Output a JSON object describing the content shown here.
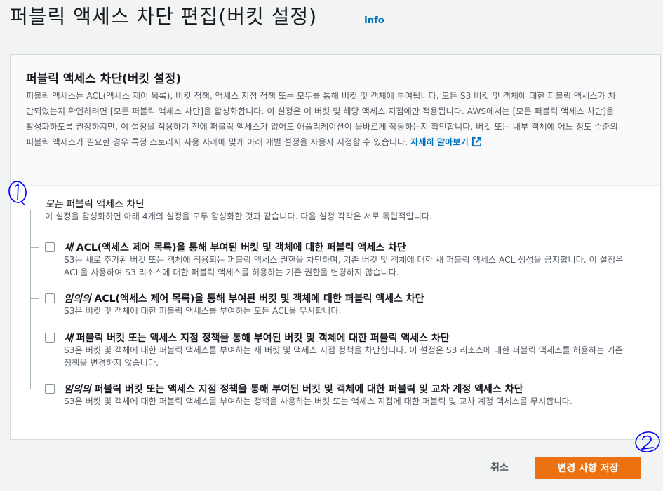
{
  "page": {
    "title": "퍼블릭 액세스 차단 편집(버킷 설정)",
    "info_link": "Info"
  },
  "panel": {
    "title": "퍼블릭 액세스 차단(버킷 설정)",
    "description": "퍼블릭 액세스는 ACL(액세스 제어 목록), 버킷 정책, 액세스 지점 정책 또는 모두를 통해 버킷 및 객체에 부여됩니다. 모든 S3 버킷 및 객체에 대한 퍼블릭 액세스가 차단되었는지 확인하려면 [모든 퍼블릭 액세스 차단]을 활성화합니다. 이 설정은 이 버킷 및 해당 액세스 지점에만 적용됩니다. AWS에서는 [모든 퍼블릭 액세스 차단]을 활성화하도록 권장하지만, 이 설정을 적용하기 전에 퍼블릭 액세스가 없어도 애플리케이션이 올바르게 작동하는지 확인합니다. 버킷 또는 내부 객체에 어느 정도 수준의 퍼블릭 액세스가 필요한 경우 특정 스토리지 사용 사례에 맞게 아래 개별 설정을 사용자 지정할 수 있습니다.",
    "learn_more": "자세히 알아보기",
    "external_link_icon": "external-link-icon"
  },
  "block_all": {
    "title_em": "모든",
    "title_rest": " 퍼블릭 액세스 차단",
    "description": "이 설정을 활성화하면 아래 4개의 설정을 모두 활성화한 것과 같습니다. 다음 설정 각각은 서로 독립적입니다.",
    "checked": false
  },
  "options": [
    {
      "title_em": "새",
      "title_rest": " ACL(액세스 제어 목록)을 통해 부여된 버킷 및 객체에 대한 퍼블릭 액세스 차단",
      "description": "S3는 새로 추가된 버킷 또는 객체에 적용되는 퍼블릭 액세스 권한을 차단하며, 기존 버킷 및 객체에 대한 새 퍼블릭 액세스 ACL 생성을 금지합니다. 이 설정은 ACL을 사용하여 S3 리소스에 대한 퍼블릭 액세스를 허용하는 기존 권한을 변경하지 않습니다.",
      "checked": false
    },
    {
      "title_em": "임의의",
      "title_rest": " ACL(액세스 제어 목록)을 통해 부여된 버킷 및 객체에 대한 퍼블릭 액세스 차단",
      "description": "S3은 버킷 및 객체에 대한 퍼블릭 액세스를 부여하는 모든 ACL을 무시합니다.",
      "checked": false
    },
    {
      "title_em": "새",
      "title_rest": " 퍼블릭 버킷 또는 액세스 지점 정책을 통해 부여된 버킷 및 객체에 대한 퍼블릭 액세스 차단",
      "description": "S3은 버킷 및 객체에 대한 퍼블릭 액세스를 부여하는 새 버킷 및 액세스 지점 정책을 차단합니다. 이 설정은 S3 리소스에 대한 퍼블릭 액세스를 허용하는 기존 정책을 변경하지 않습니다.",
      "checked": false
    },
    {
      "title_em": "임의의",
      "title_rest": " 퍼블릭 버킷 또는 액세스 지점 정책을 통해 부여된 버킷 및 객체에 대한 퍼블릭 및 교차 계정 액세스 차단",
      "description": "S3은 버킷 및 객체에 대한 퍼블릭 액세스를 부여하는 정책을 사용하는 버킷 또는 액세스 지점에 대한 퍼블릭 및 교차 계정 액세스를 무시합니다.",
      "checked": false
    }
  ],
  "annotations": {
    "first": "1",
    "second": "2",
    "color": "#0000ff"
  },
  "footer": {
    "cancel_label": "취소",
    "save_label": "변경 사항 저장"
  },
  "colors": {
    "link": "#0073bb",
    "primary_button": "#ec7211",
    "background": "#f2f3f3"
  }
}
